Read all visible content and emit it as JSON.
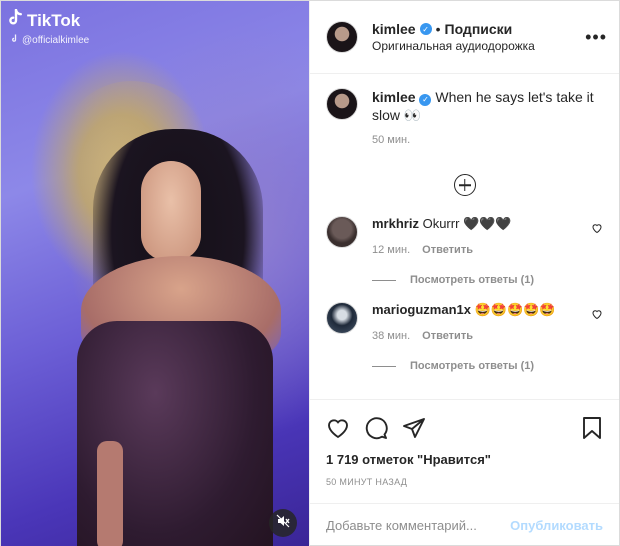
{
  "media": {
    "watermark_brand": "TikTok",
    "watermark_handle": "@officialkimlee"
  },
  "header": {
    "username": "kimlee",
    "separator": "•",
    "follow_label": "Подписки",
    "audio": "Оригинальная аудиодорожка",
    "more_label": "•••"
  },
  "caption": {
    "username": "kimlee",
    "text": "When he says let's take it slow 👀",
    "time": "50 мин."
  },
  "comments": [
    {
      "username": "mrkhriz",
      "text": "Okurrr 🖤🖤🖤",
      "time": "12 мин.",
      "reply": "Ответить",
      "view_replies": "Посмотреть ответы (1)"
    },
    {
      "username": "marioguzman1x",
      "text": "🤩🤩🤩🤩🤩",
      "time": "38 мин.",
      "reply": "Ответить",
      "view_replies": "Посмотреть ответы (1)"
    }
  ],
  "actions": {
    "likes": "1 719 отметок \"Нравится\"",
    "posted": "50 МИНУТ НАЗАД"
  },
  "add_comment": {
    "placeholder": "Добавьте комментарий...",
    "publish": "Опубликовать"
  },
  "colors": {
    "verified": "#3897f0",
    "publish_disabled": "#b3dbff"
  }
}
